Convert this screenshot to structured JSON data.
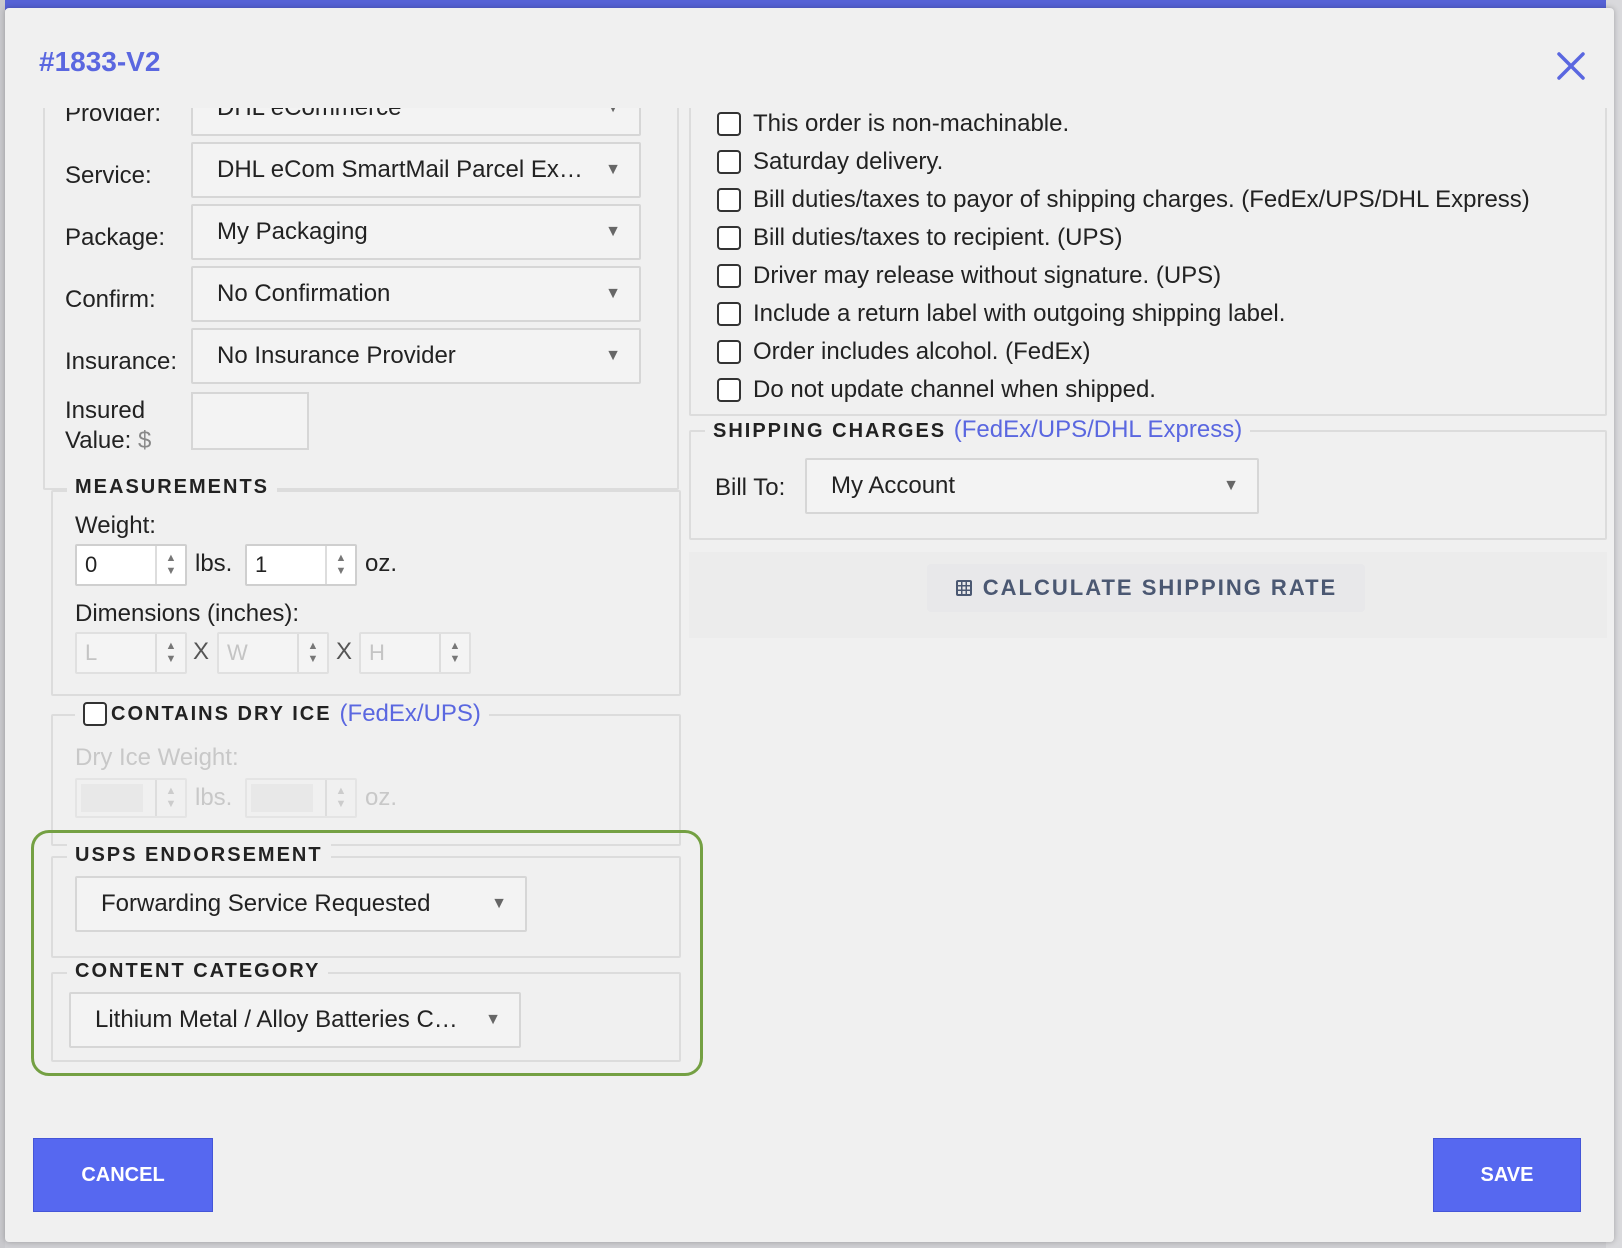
{
  "modal": {
    "title": "#1833-V2"
  },
  "shipping": {
    "provider_label": "Provider:",
    "provider_value": "DHL eCommerce",
    "service_label": "Service:",
    "service_value": "DHL eCom SmartMail Parcel Ex…",
    "package_label": "Package:",
    "package_value": "My Packaging",
    "confirm_label": "Confirm:",
    "confirm_value": "No Confirmation",
    "insurance_label": "Insurance:",
    "insurance_value": "No Insurance Provider",
    "insured_value_label_1": "Insured",
    "insured_value_label_2": "Value:",
    "insured_value_currency": "$",
    "insured_value": ""
  },
  "measurements": {
    "legend": "MEASUREMENTS",
    "weight_label": "Weight:",
    "weight_lbs": "0",
    "lbs_unit": "lbs.",
    "weight_oz": "1",
    "oz_unit": "oz.",
    "dimensions_label": "Dimensions (inches):",
    "length_placeholder": "L",
    "width_placeholder": "W",
    "height_placeholder": "H",
    "separator": "X"
  },
  "dry_ice": {
    "legend": "CONTAINS DRY ICE",
    "legend_note": "(FedEx/UPS)",
    "checked": false,
    "weight_label": "Dry Ice Weight:",
    "lbs_unit": "lbs.",
    "oz_unit": "oz."
  },
  "usps_endorsement": {
    "legend": "USPS ENDORSEMENT",
    "value": "Forwarding Service Requested"
  },
  "content_category": {
    "legend": "CONTENT CATEGORY",
    "value": "Lithium Metal / Alloy Batteries C…"
  },
  "options": [
    {
      "label": "This order is non-machinable.",
      "checked": false
    },
    {
      "label": "Saturday delivery.",
      "checked": false
    },
    {
      "label": "Bill duties/taxes to payor of shipping charges. (FedEx/UPS/DHL Express)",
      "checked": false
    },
    {
      "label": "Bill duties/taxes to recipient. (UPS)",
      "checked": false
    },
    {
      "label": "Driver may release without signature. (UPS)",
      "checked": false
    },
    {
      "label": "Include a return label with outgoing shipping label.",
      "checked": false
    },
    {
      "label": "Order includes alcohol. (FedEx)",
      "checked": false
    },
    {
      "label": "Do not update channel when shipped.",
      "checked": false
    }
  ],
  "shipping_charges": {
    "legend": "SHIPPING CHARGES",
    "legend_note": "(FedEx/UPS/DHL Express)",
    "bill_to_label": "Bill To:",
    "bill_to_value": "My Account"
  },
  "actions": {
    "calculate_label": "CALCULATE SHIPPING RATE",
    "cancel_label": "CANCEL",
    "save_label": "SAVE"
  },
  "colors": {
    "accent": "#5a67e0",
    "primary_button": "#5668f0",
    "highlight_border": "#74a043"
  },
  "icons": {
    "close": "close-icon",
    "dropdown": "caret-down-icon",
    "calculator": "calculator-icon"
  }
}
